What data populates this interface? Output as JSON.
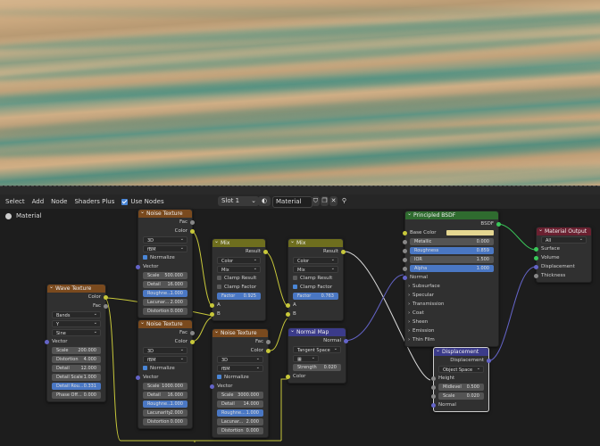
{
  "header": {
    "menus": [
      "Select",
      "Add",
      "Node",
      "Shaders Plus"
    ],
    "use_nodes_label": "Use Nodes",
    "slot_label": "Slot 1",
    "material_name": "Material"
  },
  "breadcrumb": "Material",
  "nodes": {
    "wave": {
      "title": "Wave Texture",
      "out_color": "Color",
      "out_fac": "Fac",
      "type": "Bands",
      "axis": "Y",
      "profile": "Sine",
      "in_vector": "Vector",
      "fields": [
        {
          "k": "Scale",
          "v": "200.000"
        },
        {
          "k": "Distortion",
          "v": "4.000"
        },
        {
          "k": "Detail",
          "v": "12.000"
        },
        {
          "k": "Detail Scale",
          "v": "1.000"
        },
        {
          "k": "Detail Rou...",
          "v": "0.331"
        },
        {
          "k": "Phase Off...",
          "v": "0.000"
        }
      ]
    },
    "noise1": {
      "title": "Noise Texture",
      "out_fac": "Fac",
      "out_color": "Color",
      "dim": "3D",
      "type": "fBM",
      "normalize": "Normalize",
      "in_vector": "Vector",
      "fields": [
        {
          "k": "Scale",
          "v": "500.000"
        },
        {
          "k": "Detail",
          "v": "16.000"
        },
        {
          "k": "Roughne...",
          "v": "1.000"
        },
        {
          "k": "Lacunar...",
          "v": "2.000"
        },
        {
          "k": "Distortion",
          "v": "0.000"
        }
      ]
    },
    "noise2": {
      "title": "Noise Texture",
      "out_fac": "Fac",
      "out_color": "Color",
      "dim": "3D",
      "type": "fBM",
      "normalize": "Normalize",
      "in_vector": "Vector",
      "fields": [
        {
          "k": "Scale",
          "v": "1000.000"
        },
        {
          "k": "Detail",
          "v": "16.000"
        },
        {
          "k": "Roughne...",
          "v": "1.000"
        },
        {
          "k": "Lacunarity",
          "v": "2.000"
        },
        {
          "k": "Distortion",
          "v": "0.000"
        }
      ]
    },
    "noise3": {
      "title": "Noise Texture",
      "out_fac": "Fac",
      "out_color": "Color",
      "dim": "3D",
      "type": "fBM",
      "normalize": "Normalize",
      "in_vector": "Vector",
      "fields": [
        {
          "k": "Scale",
          "v": "3000.000"
        },
        {
          "k": "Detail",
          "v": "14.000"
        },
        {
          "k": "Roughne...",
          "v": "1.000"
        },
        {
          "k": "Lacunar...",
          "v": "2.000"
        },
        {
          "k": "Distortion",
          "v": "0.000"
        }
      ]
    },
    "mix1": {
      "title": "Mix",
      "out_result": "Result",
      "data_type": "Color",
      "blend": "Mix",
      "clamp_result": "Clamp Result",
      "clamp_factor": "Clamp Factor",
      "factor_k": "Factor",
      "factor_v": "0.925",
      "in_a": "A",
      "in_b": "B"
    },
    "mix2": {
      "title": "Mix",
      "out_result": "Result",
      "data_type": "Color",
      "blend": "Mix",
      "clamp_result": "Clamp Result",
      "clamp_factor": "Clamp Factor",
      "factor_k": "Factor",
      "factor_v": "0.763",
      "in_a": "A",
      "in_b": "B"
    },
    "normalmap": {
      "title": "Normal Map",
      "out_normal": "Normal",
      "space": "Tangent Space",
      "strength_k": "Strength",
      "strength_v": "0.020",
      "in_color": "Color"
    },
    "bsdf": {
      "title": "Principled BSDF",
      "out_bsdf": "BSDF",
      "base_color": "Base Color",
      "fields": [
        {
          "k": "Metallic",
          "v": "0.000"
        },
        {
          "k": "Roughness",
          "v": "0.859"
        },
        {
          "k": "IOR",
          "v": "1.500"
        },
        {
          "k": "Alpha",
          "v": "1.000"
        }
      ],
      "normal": "Normal",
      "panels": [
        "Subsurface",
        "Specular",
        "Transmission",
        "Coat",
        "Sheen",
        "Emission",
        "Thin Film"
      ]
    },
    "output": {
      "title": "Material Output",
      "target": "All",
      "inputs": [
        "Surface",
        "Volume",
        "Displacement",
        "Thickness"
      ]
    },
    "displacement": {
      "title": "Displacement",
      "out_disp": "Displacement",
      "space": "Object Space",
      "in_height": "Height",
      "fields": [
        {
          "k": "Midlevel",
          "v": "0.500"
        },
        {
          "k": "Scale",
          "v": "0.020"
        }
      ],
      "in_normal": "Normal"
    }
  },
  "colors": {
    "texture_header": "#7a4a1e",
    "converter_header": "#6e6e1e",
    "vector_header": "#3b3b8a",
    "shader_header": "#2f6b2f",
    "output_header": "#6a2030",
    "accent_blue": "#4a77c3"
  }
}
